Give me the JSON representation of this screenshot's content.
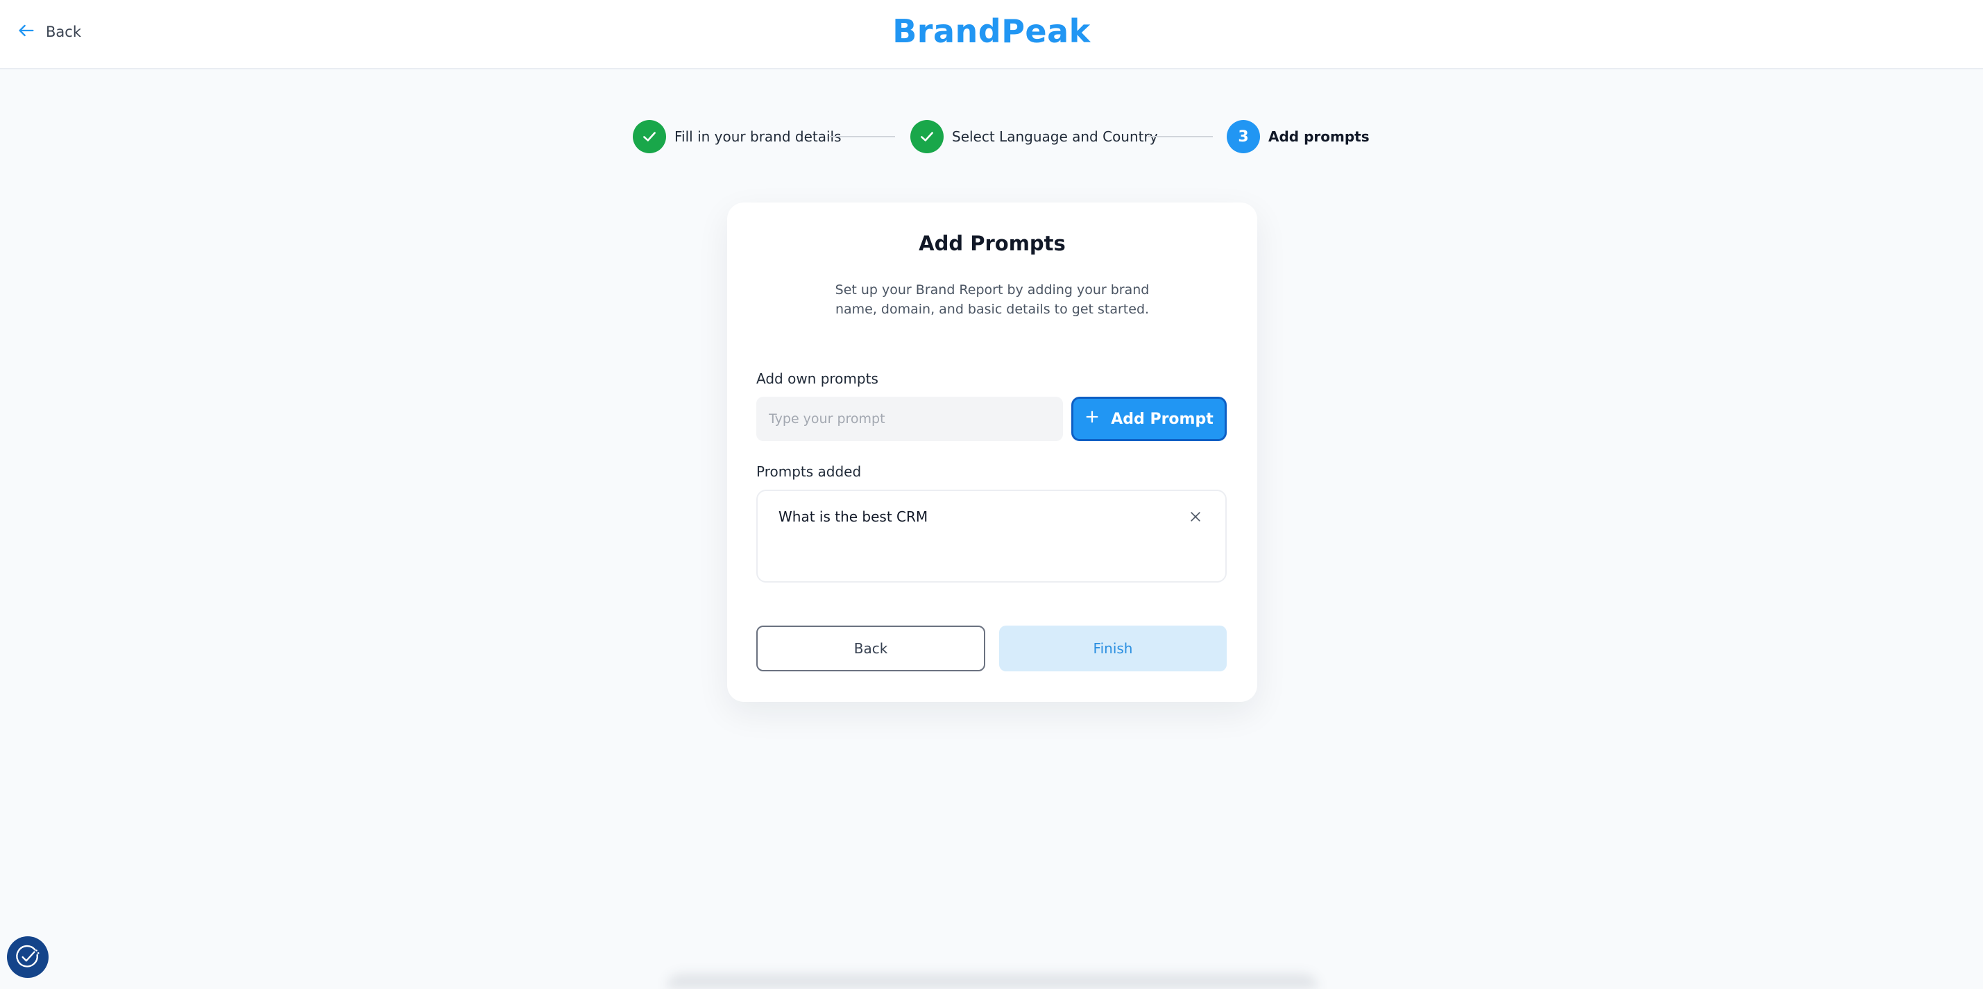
{
  "header": {
    "back_label": "Back",
    "logo": "BrandPeak"
  },
  "stepper": {
    "steps": [
      {
        "label": "Fill in your brand details",
        "status": "done"
      },
      {
        "label": "Select Language and Country",
        "status": "done"
      },
      {
        "number": "3",
        "label": "Add prompts",
        "status": "current"
      }
    ]
  },
  "card": {
    "title": "Add Prompts",
    "description": "Set up your Brand Report by adding your brand name, domain, and basic details to get started.",
    "own_prompts_label": "Add own prompts",
    "prompt_input": {
      "value": "",
      "placeholder": "Type your prompt"
    },
    "add_button_label": "Add Prompt",
    "prompts_added_label": "Prompts added",
    "prompts": [
      "What is the best CRM"
    ],
    "back_button_label": "Back",
    "finish_button_label": "Finish"
  },
  "colors": {
    "brand": "#2196f3",
    "success": "#19a74a",
    "finish_disabled_bg": "#d7ecfb",
    "cookie_badge": "#14448a"
  },
  "icons": {
    "back": "arrow-left-icon",
    "step_done": "check-icon",
    "add": "plus-icon",
    "remove": "close-icon",
    "cookie": "cookie-consent-icon"
  }
}
